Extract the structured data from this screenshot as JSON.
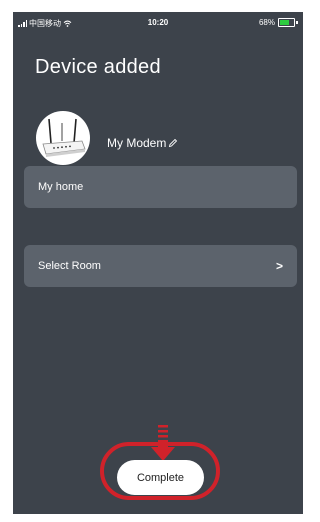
{
  "status_bar": {
    "carrier": "中国移动",
    "time": "10:20",
    "battery": "68%"
  },
  "page": {
    "title": "Device added"
  },
  "device": {
    "name": "My Modem",
    "edit_icon": "pencil-icon"
  },
  "rows": {
    "home_label": "My home",
    "room_label": "Select Room",
    "room_chevron": ">"
  },
  "actions": {
    "complete_label": "Complete"
  },
  "colors": {
    "screen_bg": "#3d434b",
    "row_bg": "#5c636c",
    "highlight_red": "#d0222a",
    "battery_green": "#2ecc40"
  }
}
